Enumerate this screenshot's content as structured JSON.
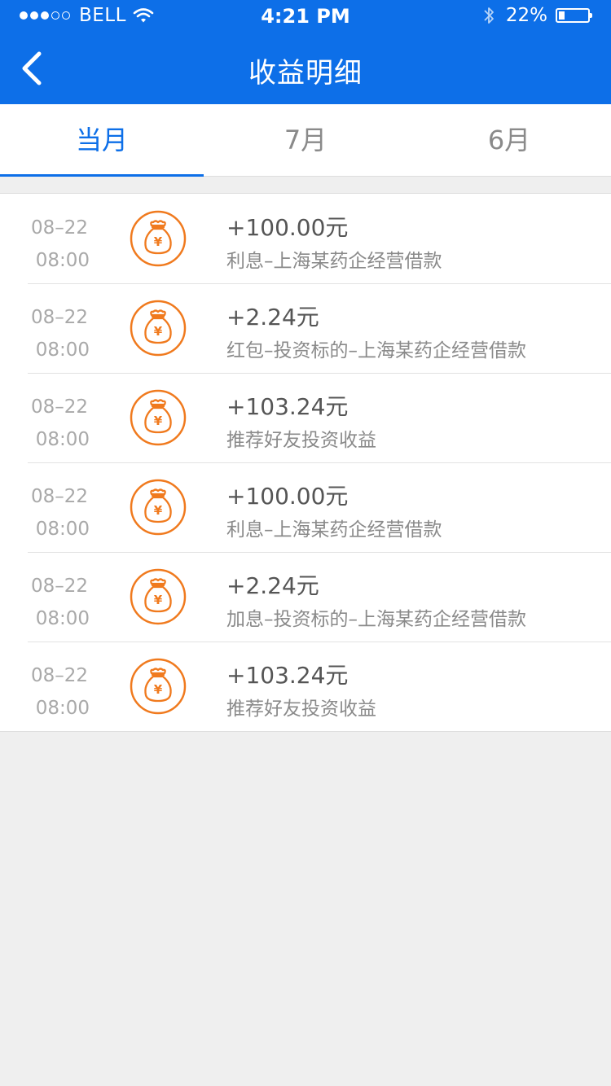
{
  "status_bar": {
    "carrier": "BELL",
    "time": "4:21 PM",
    "battery": "22%",
    "battery_level": 0.22,
    "signal_bars": 3,
    "signal_total": 5
  },
  "header": {
    "title": "收益明细",
    "back_icon": "chevron-left-icon"
  },
  "tabs": [
    {
      "label": "当月",
      "active": true
    },
    {
      "label": "7月",
      "active": false
    },
    {
      "label": "6月",
      "active": false
    }
  ],
  "records": [
    {
      "date": "08–22",
      "time": "08:00",
      "amount": "+100.00元",
      "desc": "利息–上海某药企经营借款",
      "icon": "money-bag-yen-icon"
    },
    {
      "date": "08–22",
      "time": "08:00",
      "amount": "+2.24元",
      "desc": "红包–投资标的–上海某药企经营借款",
      "icon": "money-bag-yen-icon"
    },
    {
      "date": "08–22",
      "time": "08:00",
      "amount": "+103.24元",
      "desc": "推荐好友投资收益",
      "icon": "money-bag-yen-icon"
    },
    {
      "date": "08–22",
      "time": "08:00",
      "amount": "+100.00元",
      "desc": "利息–上海某药企经营借款",
      "icon": "money-bag-yen-icon"
    },
    {
      "date": "08–22",
      "time": "08:00",
      "amount": "+2.24元",
      "desc": "加息–投资标的–上海某药企经营借款",
      "icon": "money-bag-yen-icon"
    },
    {
      "date": "08–22",
      "time": "08:00",
      "amount": "+103.24元",
      "desc": "推荐好友投资收益",
      "icon": "money-bag-yen-icon"
    }
  ],
  "colors": {
    "brand": "#0d6fe8",
    "icon_accent": "#f07a1e",
    "background": "#efefef"
  }
}
